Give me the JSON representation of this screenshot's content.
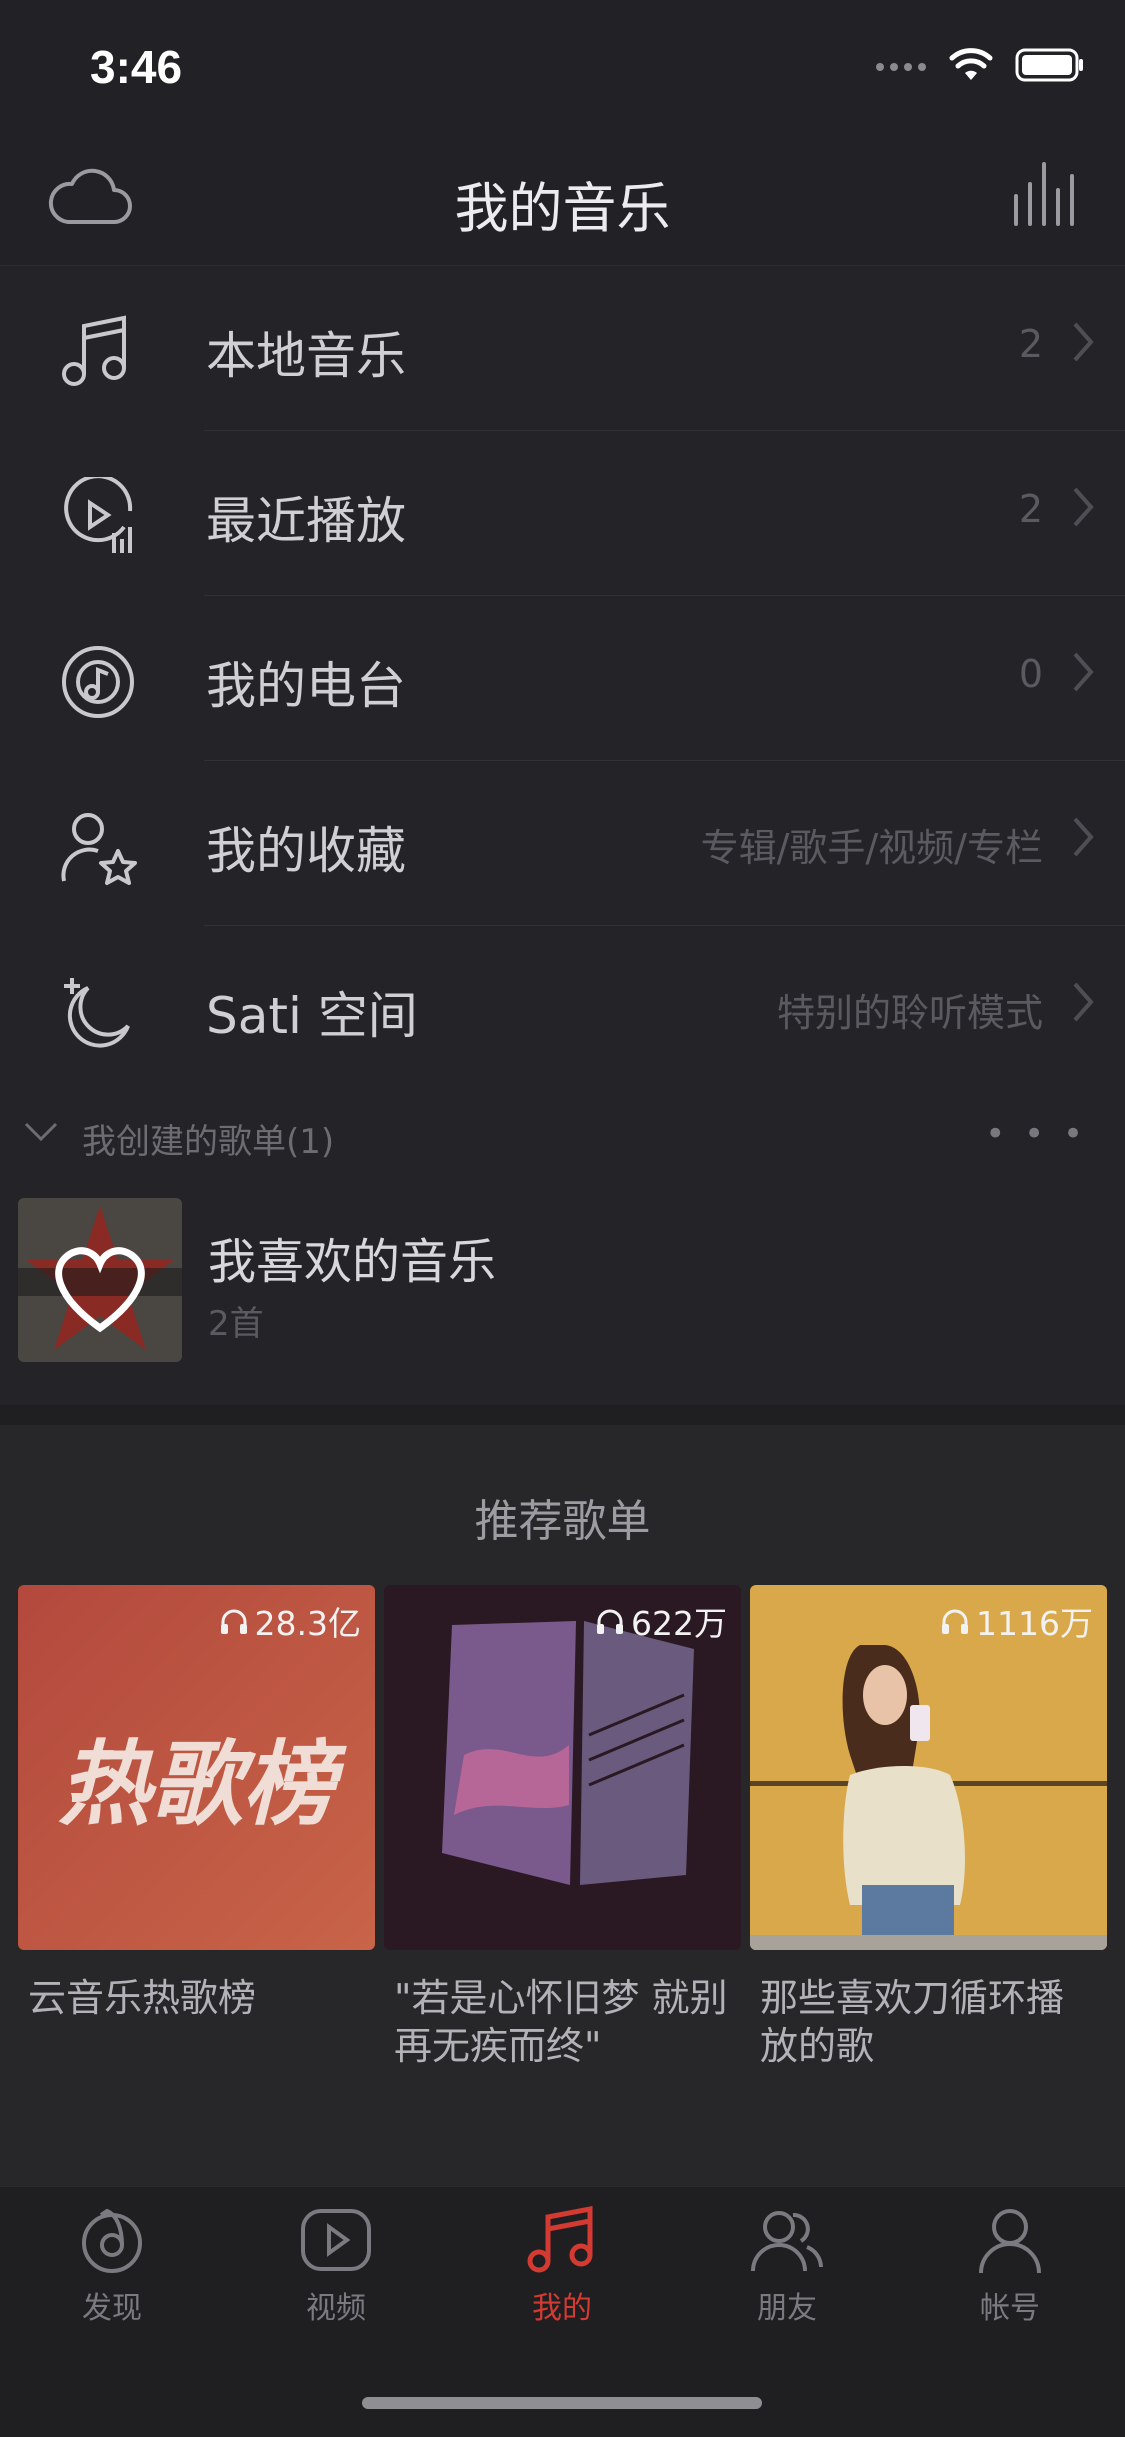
{
  "status": {
    "time": "3:46"
  },
  "header": {
    "title": "我的音乐",
    "left_icon": "cloud-icon",
    "right_icon": "equalizer-icon"
  },
  "menu": [
    {
      "label": "本地音乐",
      "right": "2",
      "icon": "music-note-icon"
    },
    {
      "label": "最近播放",
      "right": "2",
      "icon": "recent-play-icon"
    },
    {
      "label": "我的电台",
      "right": "0",
      "icon": "radio-icon"
    },
    {
      "label": "我的收藏",
      "right": "专辑/歌手/视频/专栏",
      "icon": "favorite-person-icon"
    },
    {
      "label": "Sati 空间",
      "right": "特别的聆听模式",
      "icon": "moon-icon"
    }
  ],
  "created_section": {
    "title": "我创建的歌单(1)",
    "more": "• • •"
  },
  "playlist": {
    "name": "我喜欢的音乐",
    "count": "2首"
  },
  "recommend": {
    "title": "推荐歌单",
    "cards": [
      {
        "plays": "28.3亿",
        "caption": "云音乐热歌榜",
        "cover_text": "热歌榜"
      },
      {
        "plays": "622万",
        "caption": "\"若是心怀旧梦 就别再无疾而终\""
      },
      {
        "plays": "1116万",
        "caption": "那些喜欢刀循环播放的歌"
      }
    ]
  },
  "tabs": [
    {
      "label": "发现",
      "icon": "discover-icon",
      "active": false
    },
    {
      "label": "视频",
      "icon": "video-icon",
      "active": false
    },
    {
      "label": "我的",
      "icon": "music-note-icon",
      "active": true
    },
    {
      "label": "朋友",
      "icon": "friends-icon",
      "active": false
    },
    {
      "label": "帐号",
      "icon": "account-icon",
      "active": false
    }
  ],
  "colors": {
    "accent": "#d33a31",
    "background": "#242428"
  }
}
